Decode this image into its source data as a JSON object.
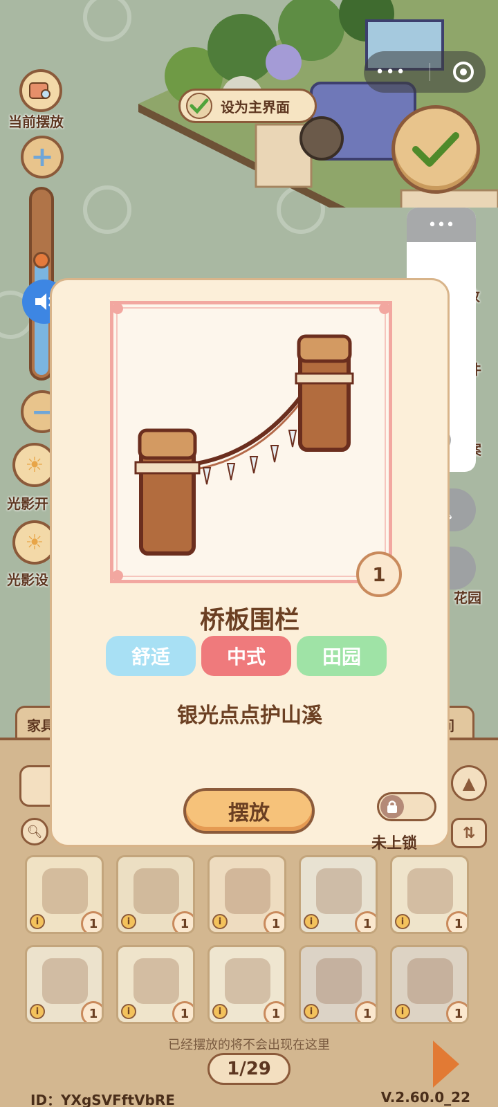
{
  "top_bar": {
    "current_placement_label": "当前摆放",
    "set_main_label": "设为主界面",
    "capsule_more": "•••",
    "zoom_level_fraction": 0.62
  },
  "side_left": {
    "light_effect_1_label": "光影开",
    "light_effect_2_label": "光影设"
  },
  "side_right": {
    "label_1": "改",
    "label_2": "件",
    "label_3": "案",
    "label_4": "花园"
  },
  "wechat_panel": {
    "more": "•••"
  },
  "popup": {
    "count": "1",
    "name": "桥板围栏",
    "tags": [
      {
        "label": "舒适",
        "color": "#a8e0f4"
      },
      {
        "label": "中式",
        "color": "#ef7a7c"
      },
      {
        "label": "田园",
        "color": "#9fe3a6"
      }
    ],
    "description": "银光点点护山溪",
    "place_button": "摆放",
    "lock_label": "未上锁",
    "locked": false
  },
  "inventory": {
    "tab_left": "家具",
    "tab_right": "间",
    "slots": [
      {
        "icon": "owl-plush-icon",
        "count": "1",
        "info": "i"
      },
      {
        "icon": "book-stack-icon",
        "count": "1",
        "info": "i"
      },
      {
        "icon": "hamster-books-icon",
        "count": "1",
        "info": "i"
      },
      {
        "icon": "blue-flower-bush-icon",
        "count": "1",
        "info": "i"
      },
      {
        "icon": "picnic-mat-icon",
        "count": "1",
        "info": "i"
      },
      {
        "icon": "crystal-ball-icon",
        "count": "1",
        "info": "i"
      },
      {
        "icon": "hen-icon",
        "count": "1",
        "info": "i"
      },
      {
        "icon": "flower-vine-icon",
        "count": "1",
        "info": "i"
      },
      {
        "icon": "vanity-dresser-icon",
        "count": "1",
        "info": "i"
      },
      {
        "icon": "bridge-fence-icon",
        "count": "1",
        "info": "i"
      }
    ],
    "hint": "已经摆放的将不会出现在这里",
    "page": "1/29"
  },
  "footer": {
    "user_id": "ID：YXgSVFftVbRE",
    "version": "V.2.60.0_22"
  },
  "colors": {
    "accent_brown": "#8b5a3a",
    "card_bg": "#fcefd9",
    "frame_pink": "#f2a7a0",
    "place_button": "#f6c27a"
  }
}
